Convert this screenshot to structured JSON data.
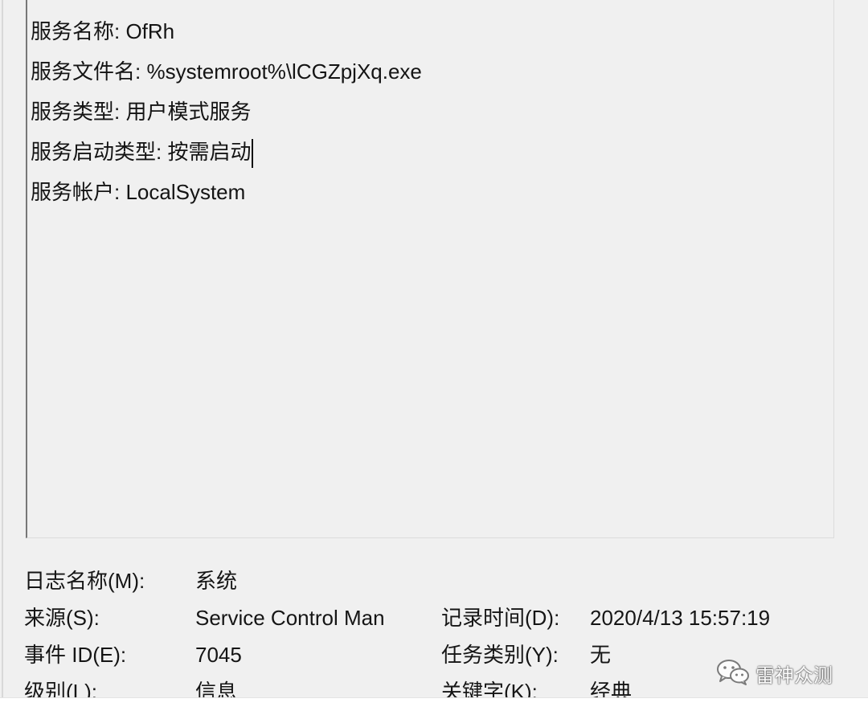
{
  "description": {
    "lines": [
      "服务名称: OfRh",
      "服务文件名: %systemroot%\\lCGZpjXq.exe",
      "服务类型: 用户模式服务",
      "服务启动类型: 按需启动",
      "服务帐户: LocalSystem"
    ]
  },
  "details": {
    "log_name_label": "日志名称(M):",
    "log_name_value": "系统",
    "source_label": "来源(S):",
    "source_value": "Service Control Man",
    "logged_label": "记录时间(D):",
    "logged_value": "2020/4/13 15:57:19",
    "event_id_label": "事件 ID(E):",
    "event_id_value": "7045",
    "task_category_label": "任务类别(Y):",
    "task_category_value": "无",
    "level_label": "级别(L):",
    "level_value": "信息",
    "keywords_label": "关键字(K):",
    "keywords_value": "经典"
  },
  "watermark": {
    "text": "雷神众测",
    "icon": "wechat-icon"
  }
}
